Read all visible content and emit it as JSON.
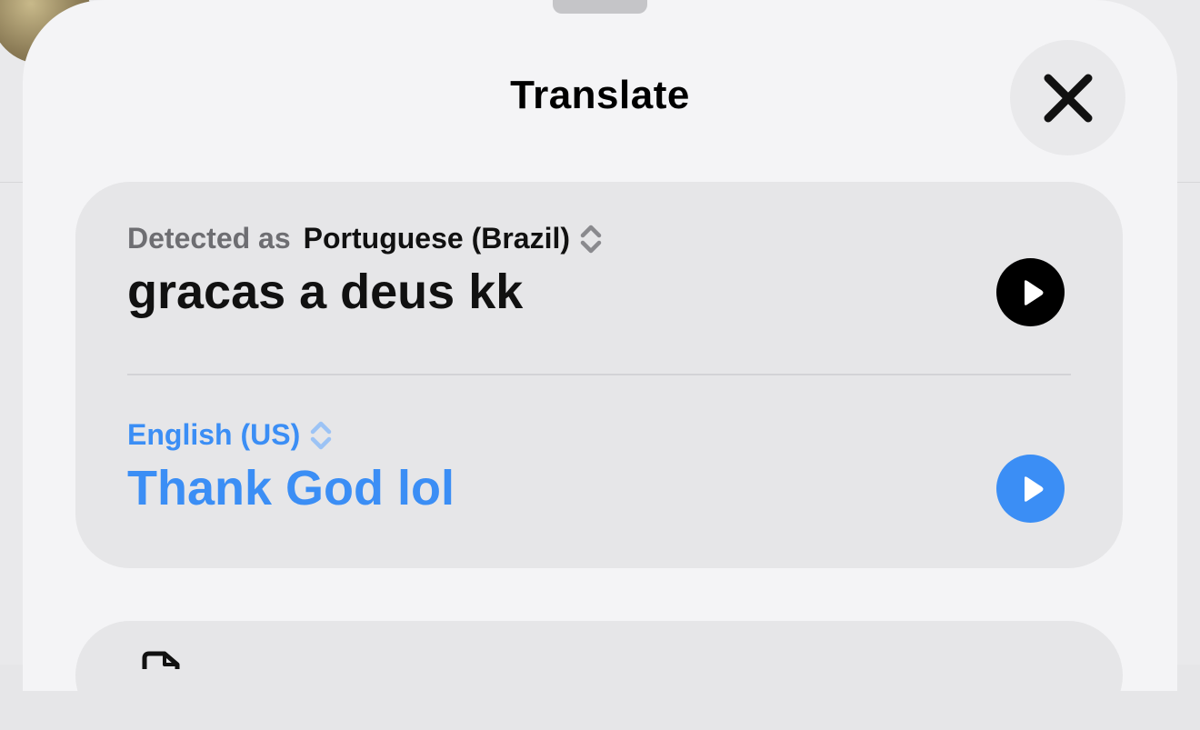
{
  "sheet": {
    "title": "Translate",
    "close_icon": "xmark-icon"
  },
  "source": {
    "prefix": "Detected as",
    "language": "Portuguese (Brazil)",
    "text": "gracas a deus kk",
    "play_icon": "play-icon"
  },
  "target": {
    "language": "English (US)",
    "text": "Thank God lol",
    "play_icon": "play-icon"
  },
  "actions": {
    "copy_icon": "copy-icon"
  },
  "colors": {
    "accent": "#3b8ef5",
    "sheet_background": "#f4f4f6",
    "card_background": "#e6e6e8",
    "secondary_text": "#6e6e72"
  }
}
